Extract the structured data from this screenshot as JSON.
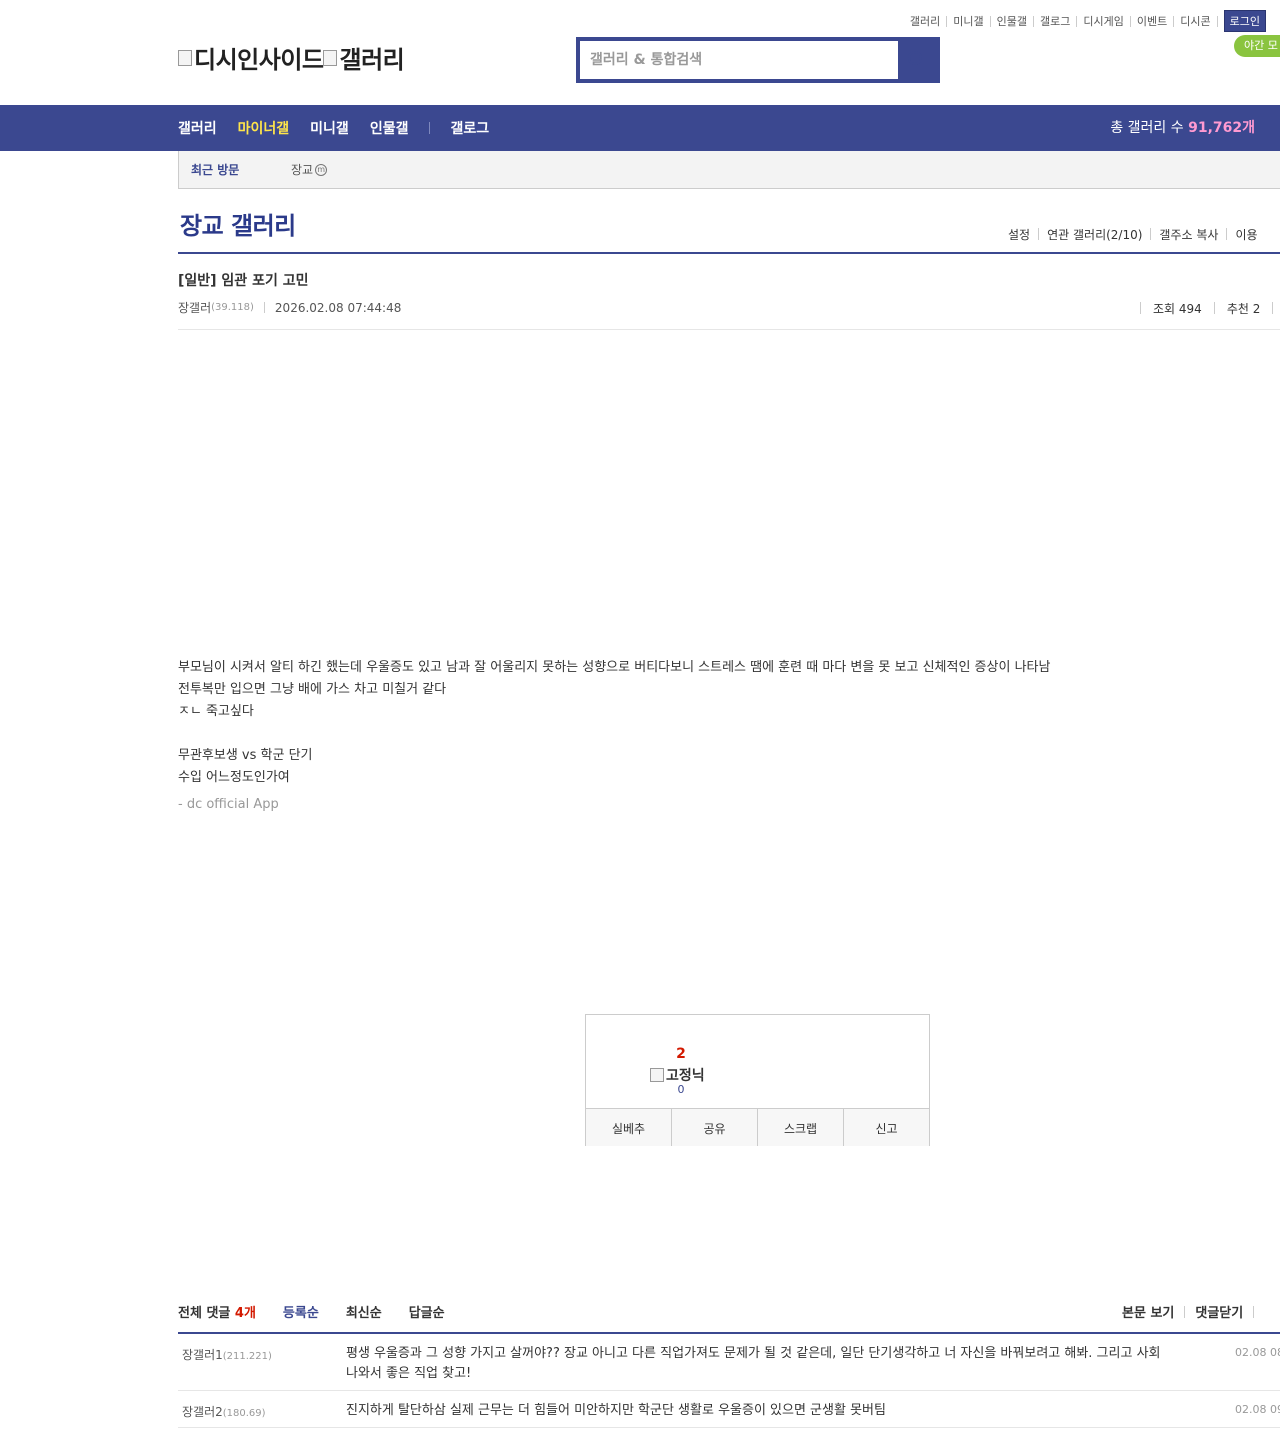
{
  "top_links": [
    "갤러리",
    "미니갤",
    "인물갤",
    "갤로그",
    "디시게임",
    "이벤트",
    "디시콘"
  ],
  "login_label": "로그인",
  "night_mode_label": "야간 모",
  "logo": {
    "site": "디시인사이드",
    "gallery": "갤러리"
  },
  "search": {
    "placeholder": "갤러리 & 통합검색"
  },
  "gnb": {
    "items": [
      "갤러리",
      "마이너갤",
      "미니갤",
      "인물갤"
    ],
    "gallog": "갤로그",
    "total_label": "총 갤러리 수",
    "total_count": "91,762개"
  },
  "recent": {
    "title": "최근 방문",
    "items": [
      {
        "label": "장교",
        "badge": "m"
      }
    ]
  },
  "gallery": {
    "title": "장교 갤러리",
    "options": [
      "설정",
      "연관 갤러리(2/10)",
      "갤주소 복사",
      "이용"
    ]
  },
  "post": {
    "title": "[일반] 임관 포기 고민",
    "author": "장갤러",
    "author_ip": "(39.118)",
    "date": "2026.02.08 07:44:48",
    "views_label": "조회 494",
    "recommend_label": "추천 2",
    "body": [
      "부모님이 시켜서 알티 하긴 했는데 우울증도 있고 남과 잘 어울리지 못하는 성향으로 버티다보니 스트레스 땜에 훈련 때 마다 변을 못 보고 신체적인 증상이",
      "나타남",
      "전투복만 입으면 그냥 배에 가스 차고 미칠거 같다",
      "ㅈㄴ 죽고싶다",
      "",
      "무관후보생 vs 학군 단기",
      "수입 어느정도인가여"
    ],
    "app_sign": "- dc official App"
  },
  "recommend": {
    "count": "2",
    "image_alt": "고정닉",
    "fixed_count": "0",
    "buttons": [
      "실베추",
      "공유",
      "스크랩",
      "신고"
    ]
  },
  "comments": {
    "total_label": "전체 댓글",
    "total_count": "4개",
    "sorts": [
      "등록순",
      "최신순",
      "답글순"
    ],
    "right_links": [
      "본문 보기",
      "댓글닫기"
    ],
    "items": [
      {
        "nick": "장갤러1",
        "ip": "(211.221)",
        "text": "평생 우울증과 그 성향 가지고 살꺼야?? 장교 아니고 다른 직업가져도 문제가 될 것 같은데, 일단 단기생각하고 너 자신을 바꿔보려고 해봐. 그리고 사회나와서 좋은 직업 찾고!",
        "date": "02.08 08"
      },
      {
        "nick": "장갤러2",
        "ip": "(180.69)",
        "text": "진지하게 탈단하삼 실제 근무는 더 힘들어 미안하지만 학군단 생활로 우울증이 있으면 군생활 못버팀",
        "date": "02.08 09"
      }
    ]
  },
  "colors": {
    "brand": "#3b4890",
    "accent_yellow": "#ffe54a",
    "count_pink": "#ff9ad1",
    "red": "#d31900",
    "night_green": "#8ac43f"
  }
}
